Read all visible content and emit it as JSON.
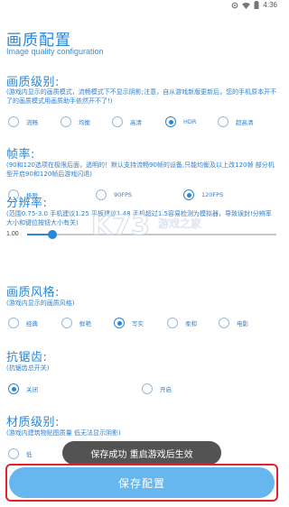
{
  "status_bar": {
    "time": "4:36"
  },
  "header": {
    "title": "画质配置",
    "subtitle": "Image quality configuration"
  },
  "quality": {
    "title": "画质级别:",
    "desc": "(游戏内显示的画质模式，流畅模式下不显示阴影;注意，自从游戏新版更新后，您的手机原本开不了的画质模式用画质助手依然开不了!)",
    "options": [
      "流畅",
      "均衡",
      "高清",
      "HDR",
      "超高清"
    ],
    "selected": "HDR"
  },
  "fps": {
    "title": "帧率:",
    "desc": "(90和120选项在极限后面，透明的！默认支持流畅90帧的设备,只能均衡及以上改120帧 部分机型开启90和120帧后游戏闪退)",
    "options": [
      "极限",
      "90FPS",
      "120FPS"
    ],
    "selected": "120FPS"
  },
  "resolution": {
    "title": "分辨率:",
    "desc": "(范围0.75-3.0 手机建议1.25 平板建议1.48 手机超过1.5容易检测为模拟器，导致误封!分辨率大小和键位按钮大小有关)",
    "value": "1.00",
    "level": 0.1
  },
  "style": {
    "title": "画质风格:",
    "desc": "(游戏内显示的画质风格)",
    "options": [
      "经典",
      "鲜艳",
      "写实",
      "柔和",
      "电影"
    ],
    "selected": "写实"
  },
  "antialias": {
    "title": "抗锯齿:",
    "desc": "(抗锯齿总开关)",
    "options": [
      "关闭",
      "开启"
    ],
    "selected": "关闭"
  },
  "material": {
    "title": "材质级别:",
    "desc": "(游戏内建筑物贴图质量 低无法显示阴影)",
    "options": [
      "低"
    ],
    "selected": ""
  },
  "watermark": {
    "text": "K73",
    "sub": "游戏之家"
  },
  "toast": {
    "text": "保存成功 重启游戏后生效"
  },
  "save_button": {
    "label": "保存配置"
  },
  "colors": {
    "accent": "#2a86d6",
    "button": "#66b6ef",
    "highlight": "#e0242c"
  }
}
